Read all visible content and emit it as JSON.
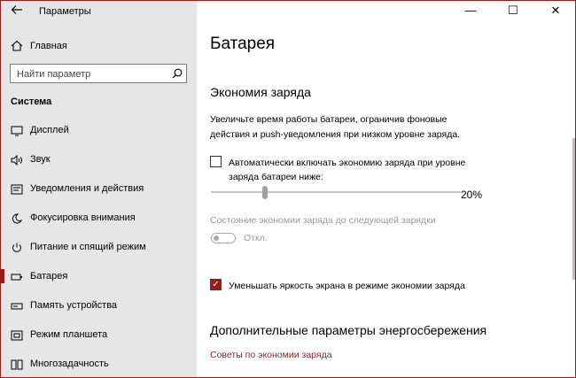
{
  "window": {
    "title": "Параметры",
    "controls": {
      "minimize": "—",
      "maximize": "☐",
      "close": "✕"
    }
  },
  "sidebar": {
    "back_icon": "back-arrow-icon",
    "home_label": "Главная",
    "search_placeholder": "Найти параметр",
    "section_title": "Система",
    "items": [
      {
        "label": "Дисплей",
        "icon": "display-icon"
      },
      {
        "label": "Звук",
        "icon": "speaker-icon"
      },
      {
        "label": "Уведомления и действия",
        "icon": "notifications-icon"
      },
      {
        "label": "Фокусировка внимания",
        "icon": "moon-icon"
      },
      {
        "label": "Питание и спящий режим",
        "icon": "power-icon"
      },
      {
        "label": "Батарея",
        "icon": "battery-icon",
        "active": true
      },
      {
        "label": "Память устройства",
        "icon": "storage-icon"
      },
      {
        "label": "Режим планшета",
        "icon": "tablet-icon"
      },
      {
        "label": "Многозадачность",
        "icon": "multitasking-icon"
      }
    ]
  },
  "main": {
    "title": "Батарея",
    "saver_heading": "Экономия заряда",
    "saver_description": "Увеличьте время работы батареи, ограничив фоновые действия и push-уведомления при низком уровне заряда.",
    "auto_saver_label": "Автоматически включать экономию заряда при уровне заряда батареи ниже:",
    "auto_saver_checked": false,
    "threshold_value": "20%",
    "threshold_level": 0.2,
    "status_label": "Состояние экономии заряда до следующей зарядки",
    "toggle_label": "Откл.",
    "toggle_on": false,
    "brightness_label": "Уменьшать яркость экрана в режиме экономии заряда",
    "brightness_checked": true,
    "more_heading": "Дополнительные параметры энергосбережения",
    "link_tips": "Советы по экономии заряда",
    "accent_color": "#9b1b1b"
  }
}
